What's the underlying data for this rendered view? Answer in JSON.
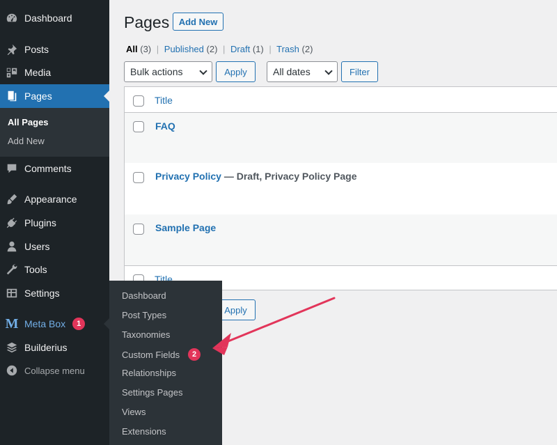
{
  "sidebar": {
    "items": [
      {
        "label": "Dashboard",
        "icon": "dashboard-icon"
      },
      {
        "label": "Posts",
        "icon": "pin-icon"
      },
      {
        "label": "Media",
        "icon": "media-icon"
      },
      {
        "label": "Pages",
        "icon": "pages-icon"
      },
      {
        "label": "Comments",
        "icon": "comment-icon"
      },
      {
        "label": "Appearance",
        "icon": "brush-icon"
      },
      {
        "label": "Plugins",
        "icon": "plug-icon"
      },
      {
        "label": "Users",
        "icon": "user-icon"
      },
      {
        "label": "Tools",
        "icon": "wrench-icon"
      },
      {
        "label": "Settings",
        "icon": "settings-icon"
      },
      {
        "label": "Meta Box",
        "icon": "metabox-logo",
        "badge": "1"
      },
      {
        "label": "Builderius",
        "icon": "layers-icon"
      },
      {
        "label": "Collapse menu",
        "icon": "collapse-icon"
      }
    ],
    "pages_submenu": [
      "All Pages",
      "Add New"
    ]
  },
  "flyout": {
    "items": [
      "Dashboard",
      "Post Types",
      "Taxonomies",
      "Custom Fields",
      "Relationships",
      "Settings Pages",
      "Views",
      "Extensions"
    ],
    "badge": "2"
  },
  "main": {
    "title": "Pages",
    "add_new": "Add New",
    "filters": {
      "all": "All",
      "all_count": "(3)",
      "published": "Published",
      "published_count": "(2)",
      "draft": "Draft",
      "draft_count": "(1)",
      "trash": "Trash",
      "trash_count": "(2)",
      "sep": "|"
    },
    "bulk_actions": "Bulk actions",
    "apply": "Apply",
    "all_dates": "All dates",
    "filter": "Filter",
    "table": {
      "header": "Title",
      "rows": [
        {
          "title": "FAQ",
          "state": ""
        },
        {
          "title": "Privacy Policy",
          "state": " — Draft, Privacy Policy Page"
        },
        {
          "title": "Sample Page",
          "state": ""
        }
      ],
      "footer": "Title"
    }
  },
  "colors": {
    "sidebar_bg": "#1d2327",
    "accent": "#2271b1",
    "badge": "#e2355a"
  }
}
